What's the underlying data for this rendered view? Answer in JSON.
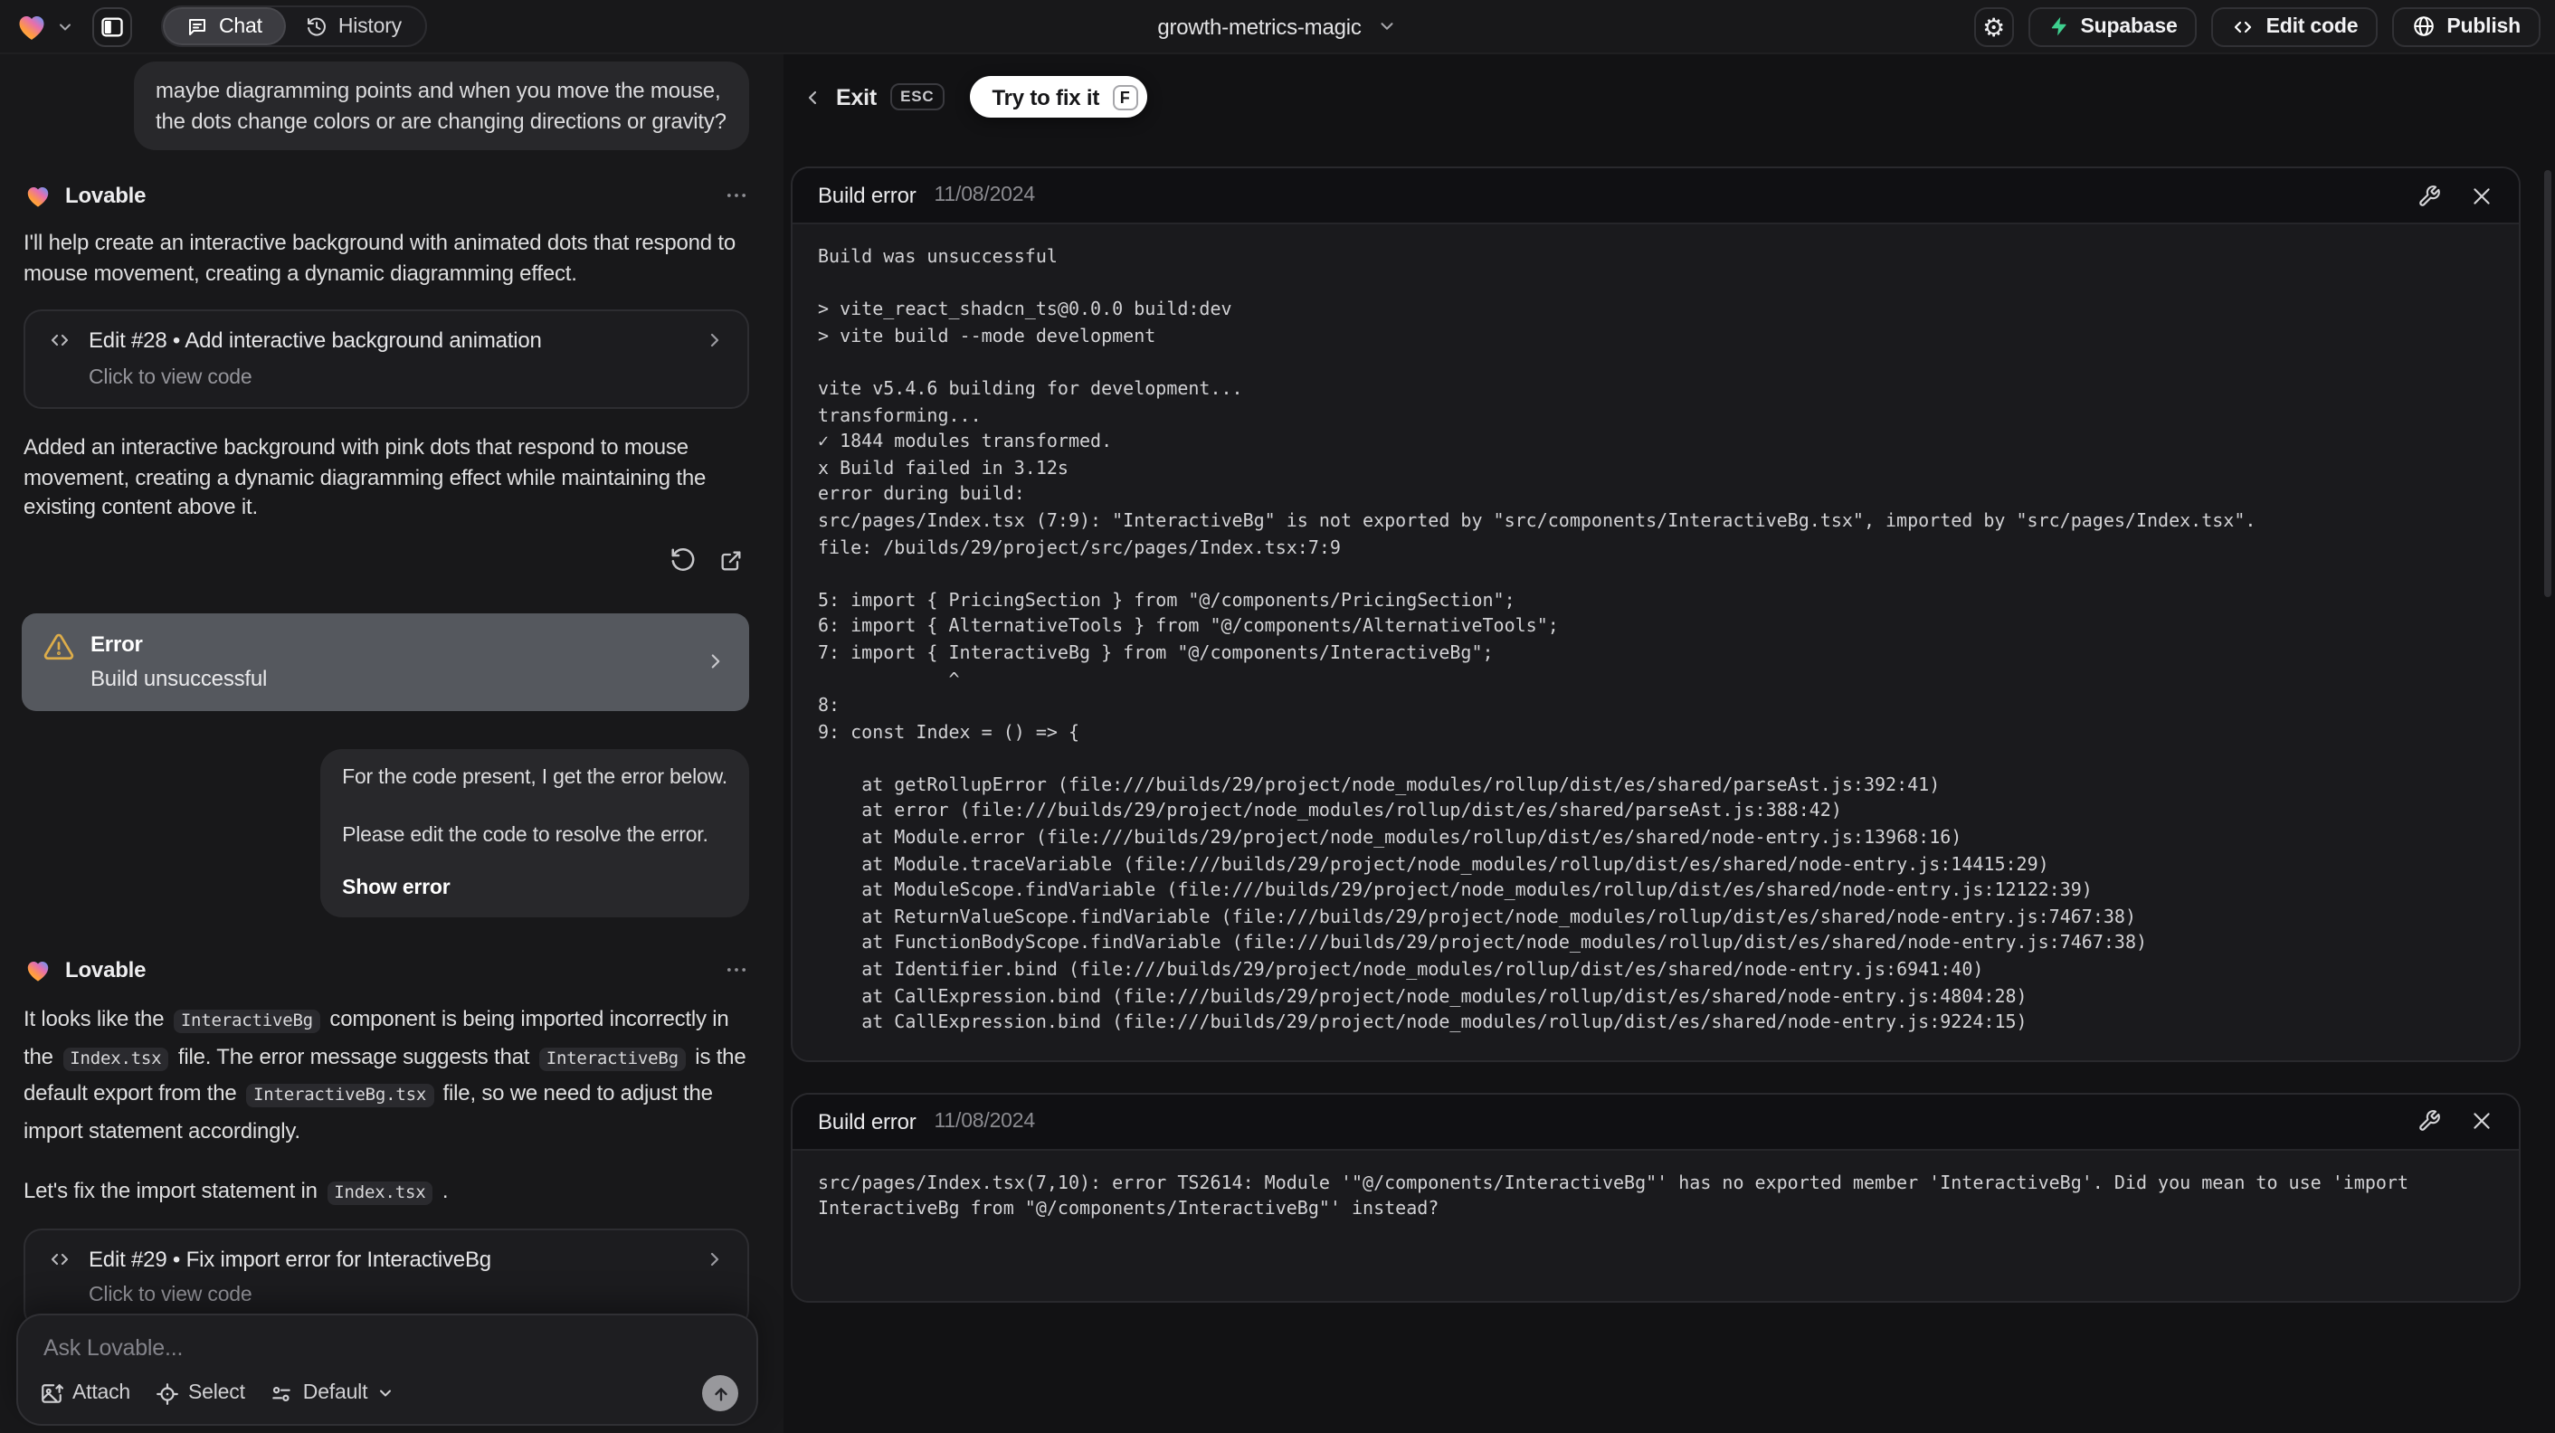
{
  "icons": {
    "lovable-logo": "gradient-heart",
    "workspace-chevron": "chevron-down",
    "sidebar-toggle": "panel-left",
    "chat-tab": "message-bubble",
    "history-tab": "clock-history",
    "project-chevron": "chevron-down",
    "settings": "gear",
    "gear_glyph": "⚙",
    "supabase": "lightning-bolt",
    "edit-code": "angle-brackets",
    "publish": "globe",
    "exit": "chevron-left",
    "wrench": "wrench",
    "close": "x",
    "more": "ellipsis",
    "refresh": "rotate-arrow",
    "open-preview": "external-link",
    "warning": "alert-triangle",
    "card-arrow": "chevron-right",
    "attach": "image",
    "select": "target",
    "model": "sliders",
    "send": "arrow-up"
  },
  "topbar": {
    "tabs": {
      "chat": "Chat",
      "history": "History"
    },
    "project_name": "growth-metrics-magic",
    "actions": {
      "supabase": "Supabase",
      "edit_code": "Edit code",
      "publish": "Publish"
    }
  },
  "chat": {
    "assistant_name": "Lovable",
    "user_message_1": "maybe diagramming points and when you move the mouse, the dots change colors or are changing directions or gravity?",
    "assistant_intro": "I'll help create an interactive background with animated dots that respond to mouse movement, creating a dynamic diagramming effect.",
    "edit_card_28": {
      "title": "Edit #28 • Add interactive background animation",
      "subtitle": "Click to view code"
    },
    "assistant_summary": "Added an interactive background with pink dots that respond to mouse movement, creating a dynamic diagramming effect while maintaining the existing content above it.",
    "error_card": {
      "title": "Error",
      "subtitle": "Build unsuccessful"
    },
    "user_message_2": {
      "line_1": "For the code present, I get the error below.",
      "line_2": "Please edit the code to resolve the error.",
      "action": "Show error"
    },
    "assistant_fix_rich": [
      {
        "t": "text",
        "v": "It looks like the "
      },
      {
        "t": "code",
        "v": "InteractiveBg"
      },
      {
        "t": "text",
        "v": " component is being imported incorrectly in the "
      },
      {
        "t": "code",
        "v": "Index.tsx"
      },
      {
        "t": "text",
        "v": " file. The error message suggests that "
      },
      {
        "t": "code",
        "v": "InteractiveBg"
      },
      {
        "t": "text",
        "v": " is the default export from the "
      },
      {
        "t": "code",
        "v": "InteractiveBg.tsx"
      },
      {
        "t": "text",
        "v": " file, so we need to adjust the import statement accordingly."
      }
    ],
    "assistant_fix_2_rich": [
      {
        "t": "text",
        "v": "Let's fix the import statement in "
      },
      {
        "t": "code",
        "v": "Index.tsx"
      },
      {
        "t": "text",
        "v": " ."
      }
    ],
    "edit_card_29": {
      "title": "Edit #29 • Fix import error for InteractiveBg",
      "subtitle": "Click to view code"
    },
    "composer": {
      "placeholder": "Ask Lovable...",
      "attach": "Attach",
      "select": "Select",
      "model": "Default"
    }
  },
  "error_panel": {
    "exit_label": "Exit",
    "exit_key": "ESC",
    "fix_label": "Try to fix it",
    "fix_key": "F",
    "cards": [
      {
        "title": "Build error",
        "date": "11/08/2024",
        "log": "Build was unsuccessful\n\n> vite_react_shadcn_ts@0.0.0 build:dev\n> vite build --mode development\n\nvite v5.4.6 building for development...\ntransforming...\n✓ 1844 modules transformed.\nx Build failed in 3.12s\nerror during build:\nsrc/pages/Index.tsx (7:9): \"InteractiveBg\" is not exported by \"src/components/InteractiveBg.tsx\", imported by \"src/pages/Index.tsx\".\nfile: /builds/29/project/src/pages/Index.tsx:7:9\n\n5: import { PricingSection } from \"@/components/PricingSection\";\n6: import { AlternativeTools } from \"@/components/AlternativeTools\";\n7: import { InteractiveBg } from \"@/components/InteractiveBg\";\n            ^\n8: \n9: const Index = () => {\n\n    at getRollupError (file:///builds/29/project/node_modules/rollup/dist/es/shared/parseAst.js:392:41)\n    at error (file:///builds/29/project/node_modules/rollup/dist/es/shared/parseAst.js:388:42)\n    at Module.error (file:///builds/29/project/node_modules/rollup/dist/es/shared/node-entry.js:13968:16)\n    at Module.traceVariable (file:///builds/29/project/node_modules/rollup/dist/es/shared/node-entry.js:14415:29)\n    at ModuleScope.findVariable (file:///builds/29/project/node_modules/rollup/dist/es/shared/node-entry.js:12122:39)\n    at ReturnValueScope.findVariable (file:///builds/29/project/node_modules/rollup/dist/es/shared/node-entry.js:7467:38)\n    at FunctionBodyScope.findVariable (file:///builds/29/project/node_modules/rollup/dist/es/shared/node-entry.js:7467:38)\n    at Identifier.bind (file:///builds/29/project/node_modules/rollup/dist/es/shared/node-entry.js:6941:40)\n    at CallExpression.bind (file:///builds/29/project/node_modules/rollup/dist/es/shared/node-entry.js:4804:28)\n    at CallExpression.bind (file:///builds/29/project/node_modules/rollup/dist/es/shared/node-entry.js:9224:15)"
      },
      {
        "title": "Build error",
        "date": "11/08/2024",
        "log": "src/pages/Index.tsx(7,10): error TS2614: Module '\"@/components/InteractiveBg\"' has no exported member 'InteractiveBg'. Did you mean to use 'import InteractiveBg from \"@/components/InteractiveBg\"' instead?"
      }
    ]
  },
  "colors": {
    "accent_supabase_green": "#3ecf8e",
    "warning_amber": "#ddad4a",
    "error_card_bg": "#55585e",
    "fix_button_bg": "#ffffff"
  }
}
